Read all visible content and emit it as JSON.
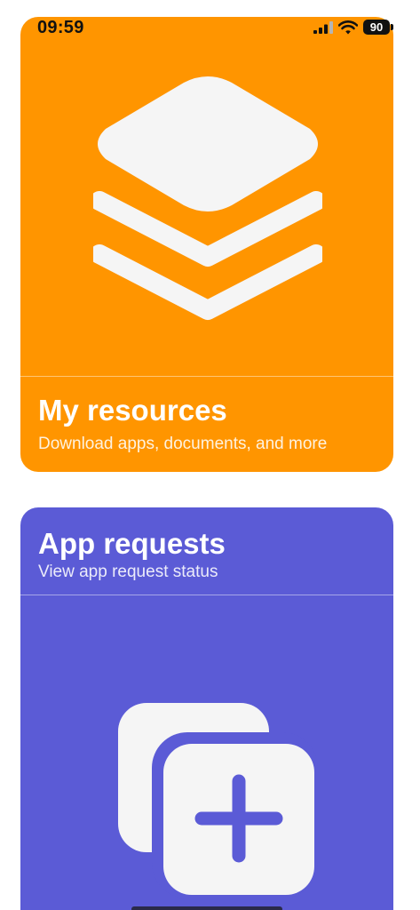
{
  "status_bar": {
    "time": "09:59",
    "battery": "90",
    "icons": [
      "signal-icon",
      "wifi-icon",
      "battery-icon"
    ]
  },
  "cards": {
    "resources": {
      "title": "My resources",
      "subtitle": "Download apps, documents, and more",
      "icon": "layers-icon",
      "color": "#FF9500"
    },
    "requests": {
      "title": "App requests",
      "subtitle": "View app request status",
      "icon": "app-add-icon",
      "color": "#5B5BD6"
    }
  }
}
